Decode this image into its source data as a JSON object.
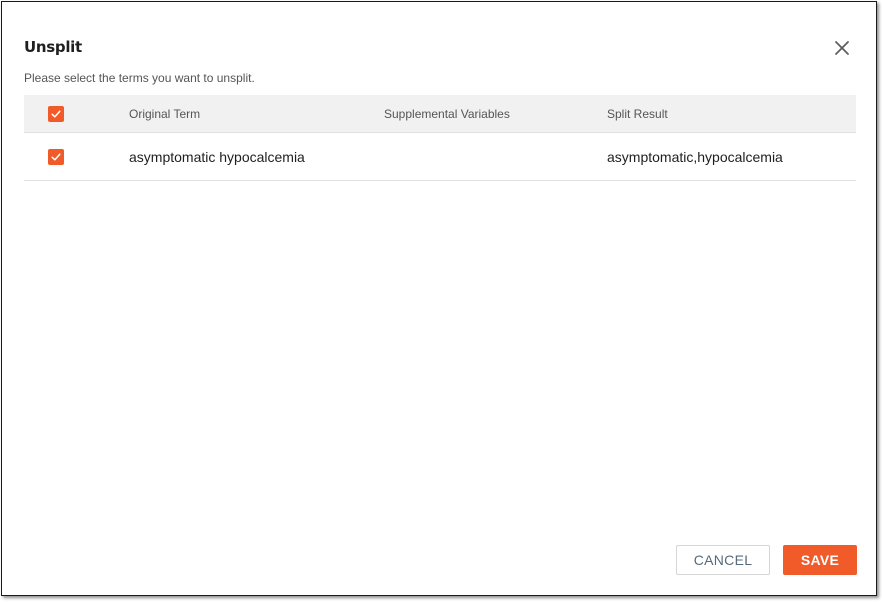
{
  "dialog": {
    "title": "Unsplit",
    "subtitle": "Please select the terms you want to unsplit.",
    "close_icon": "close-icon"
  },
  "table": {
    "select_all_checked": true,
    "columns": [
      "Original Term",
      "Supplemental Variables",
      "Split Result"
    ],
    "rows": [
      {
        "checked": true,
        "original_term": "asymptomatic hypocalcemia",
        "supplemental_variables": "",
        "split_result": "asymptomatic,hypocalcemia"
      }
    ]
  },
  "footer": {
    "cancel_label": "CANCEL",
    "save_label": "SAVE"
  },
  "colors": {
    "accent": "#f15a29",
    "header_bg": "#f1f1f1"
  }
}
